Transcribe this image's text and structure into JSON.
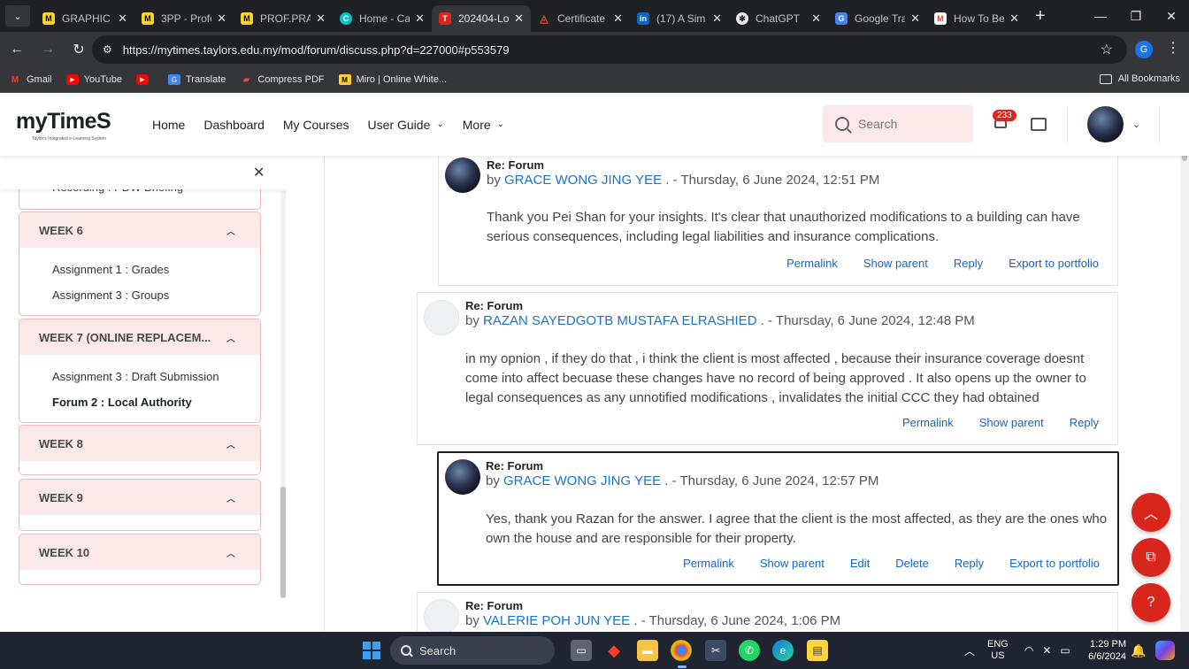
{
  "browser": {
    "tabs": [
      {
        "title": "GRAPHIC",
        "icon": "miro-icon",
        "color": "#ffd02f",
        "active": false
      },
      {
        "title": "3PP - Profe",
        "icon": "miro-icon",
        "color": "#ffd02f",
        "active": false
      },
      {
        "title": "PROF.PRAC",
        "icon": "miro-icon",
        "color": "#ffd02f",
        "active": false
      },
      {
        "title": "Home - Ca",
        "icon": "canva-icon",
        "color": "#00c4cc",
        "active": false
      },
      {
        "title": "202404-Lo",
        "icon": "mytimes-icon",
        "color": "#d9261c",
        "active": true
      },
      {
        "title": "Certificate",
        "icon": "certificate-icon",
        "color": "#e84c3d",
        "active": false
      },
      {
        "title": "(17) A Sim",
        "icon": "linkedin-icon",
        "color": "#0a66c2",
        "active": false
      },
      {
        "title": "ChatGPT",
        "icon": "chatgpt-icon",
        "color": "#e8eaed",
        "active": false
      },
      {
        "title": "Google Tra",
        "icon": "google-translate-icon",
        "color": "#4285f4",
        "active": false
      },
      {
        "title": "How To Be",
        "icon": "gmail-icon",
        "color": "#ea4335",
        "active": false
      }
    ],
    "url": "https://mytimes.taylors.edu.my/mod/forum/discuss.php?d=227000#p553579",
    "profile_initial": "G",
    "bookmarks": [
      {
        "label": "Gmail",
        "icon": "gmail-icon",
        "color": "#ea4335"
      },
      {
        "label": "YouTube",
        "icon": "youtube-icon",
        "color": "#ff0000"
      },
      {
        "label": "",
        "icon": "youtube-icon",
        "color": "#ff0000"
      },
      {
        "label": "Translate",
        "icon": "translate-icon",
        "color": "#4285f4"
      },
      {
        "label": "Compress PDF",
        "icon": "pdf-icon",
        "color": "#e84c3d"
      },
      {
        "label": "Miro | Online White...",
        "icon": "miro-icon",
        "color": "#ffd02f"
      }
    ],
    "all_bookmarks": "All Bookmarks"
  },
  "header": {
    "logo": "myTimeS",
    "logo_sub": "Taylor's Integrated e-Learning System",
    "nav": [
      {
        "label": "Home",
        "dropdown": false
      },
      {
        "label": "Dashboard",
        "dropdown": false
      },
      {
        "label": "My Courses",
        "dropdown": false
      },
      {
        "label": "User Guide",
        "dropdown": true
      },
      {
        "label": "More",
        "dropdown": true
      }
    ],
    "search_placeholder": "Search",
    "notification_count": "233"
  },
  "drawer": {
    "peek_item": "Recording : PDW Briefing",
    "weeks": [
      {
        "title": "WEEK 6",
        "items": [
          {
            "label": "Assignment 1 : Grades",
            "current": false
          },
          {
            "label": "Assignment 3 : Groups",
            "current": false
          }
        ]
      },
      {
        "title": "WEEK 7 (ONLINE REPLACEM...",
        "items": [
          {
            "label": "Assignment 3 : Draft Submission",
            "current": false
          },
          {
            "label": "Forum 2 : Local Authority",
            "current": true
          }
        ]
      },
      {
        "title": "WEEK 8",
        "items": []
      },
      {
        "title": "WEEK 9",
        "items": []
      },
      {
        "title": "WEEK 10",
        "items": []
      }
    ]
  },
  "posts": [
    {
      "subject": "Re: Forum",
      "author": "GRACE WONG JING YEE",
      "date": ". - Thursday, 6 June 2024, 12:51 PM",
      "body": "Thank you Pei Shan for your insights. It's clear that unauthorized modifications to a building can have serious consequences, including legal liabilities and insurance complications.",
      "actions": [
        "Permalink",
        "Show parent",
        "Reply",
        "Export to portfolio"
      ]
    },
    {
      "subject": "Re: Forum",
      "author": "RAZAN SAYEDGOTB MUSTAFA ELRASHIED",
      "date": ". - Thursday, 6 June 2024, 12:48 PM",
      "body": "in my opnion , if they do that , i think the client is most affected , because their insurance coverage doesnt come into affect becuase these changes have no record of being approved . It also opens up the owner to legal consequences as any unnotified modifications , invalidates the initial CCC they had obtained",
      "actions": [
        "Permalink",
        "Show parent",
        "Reply"
      ]
    },
    {
      "subject": "Re: Forum",
      "author": "GRACE WONG JING YEE",
      "date": ". - Thursday, 6 June 2024, 12:57 PM",
      "body": "Yes, thank you Razan for the answer. I agree that the client is the most affected, as they are the ones who own the house and are responsible for their property.",
      "actions": [
        "Permalink",
        "Show parent",
        "Edit",
        "Delete",
        "Reply",
        "Export to portfolio"
      ]
    },
    {
      "subject": "Re: Forum",
      "author": "VALERIE POH JUN YEE",
      "date": ". - Thursday, 6 June 2024, 1:06 PM",
      "body": "",
      "actions": []
    }
  ],
  "taskbar": {
    "search_label": "Search",
    "lang_top": "ENG",
    "lang_bottom": "US",
    "time": "1:29 PM",
    "date": "6/6/2024"
  },
  "colors": {
    "brand": "#d9261c",
    "link": "#1565c0",
    "author": "#1a73c8",
    "pink": "#fbe9e9"
  }
}
